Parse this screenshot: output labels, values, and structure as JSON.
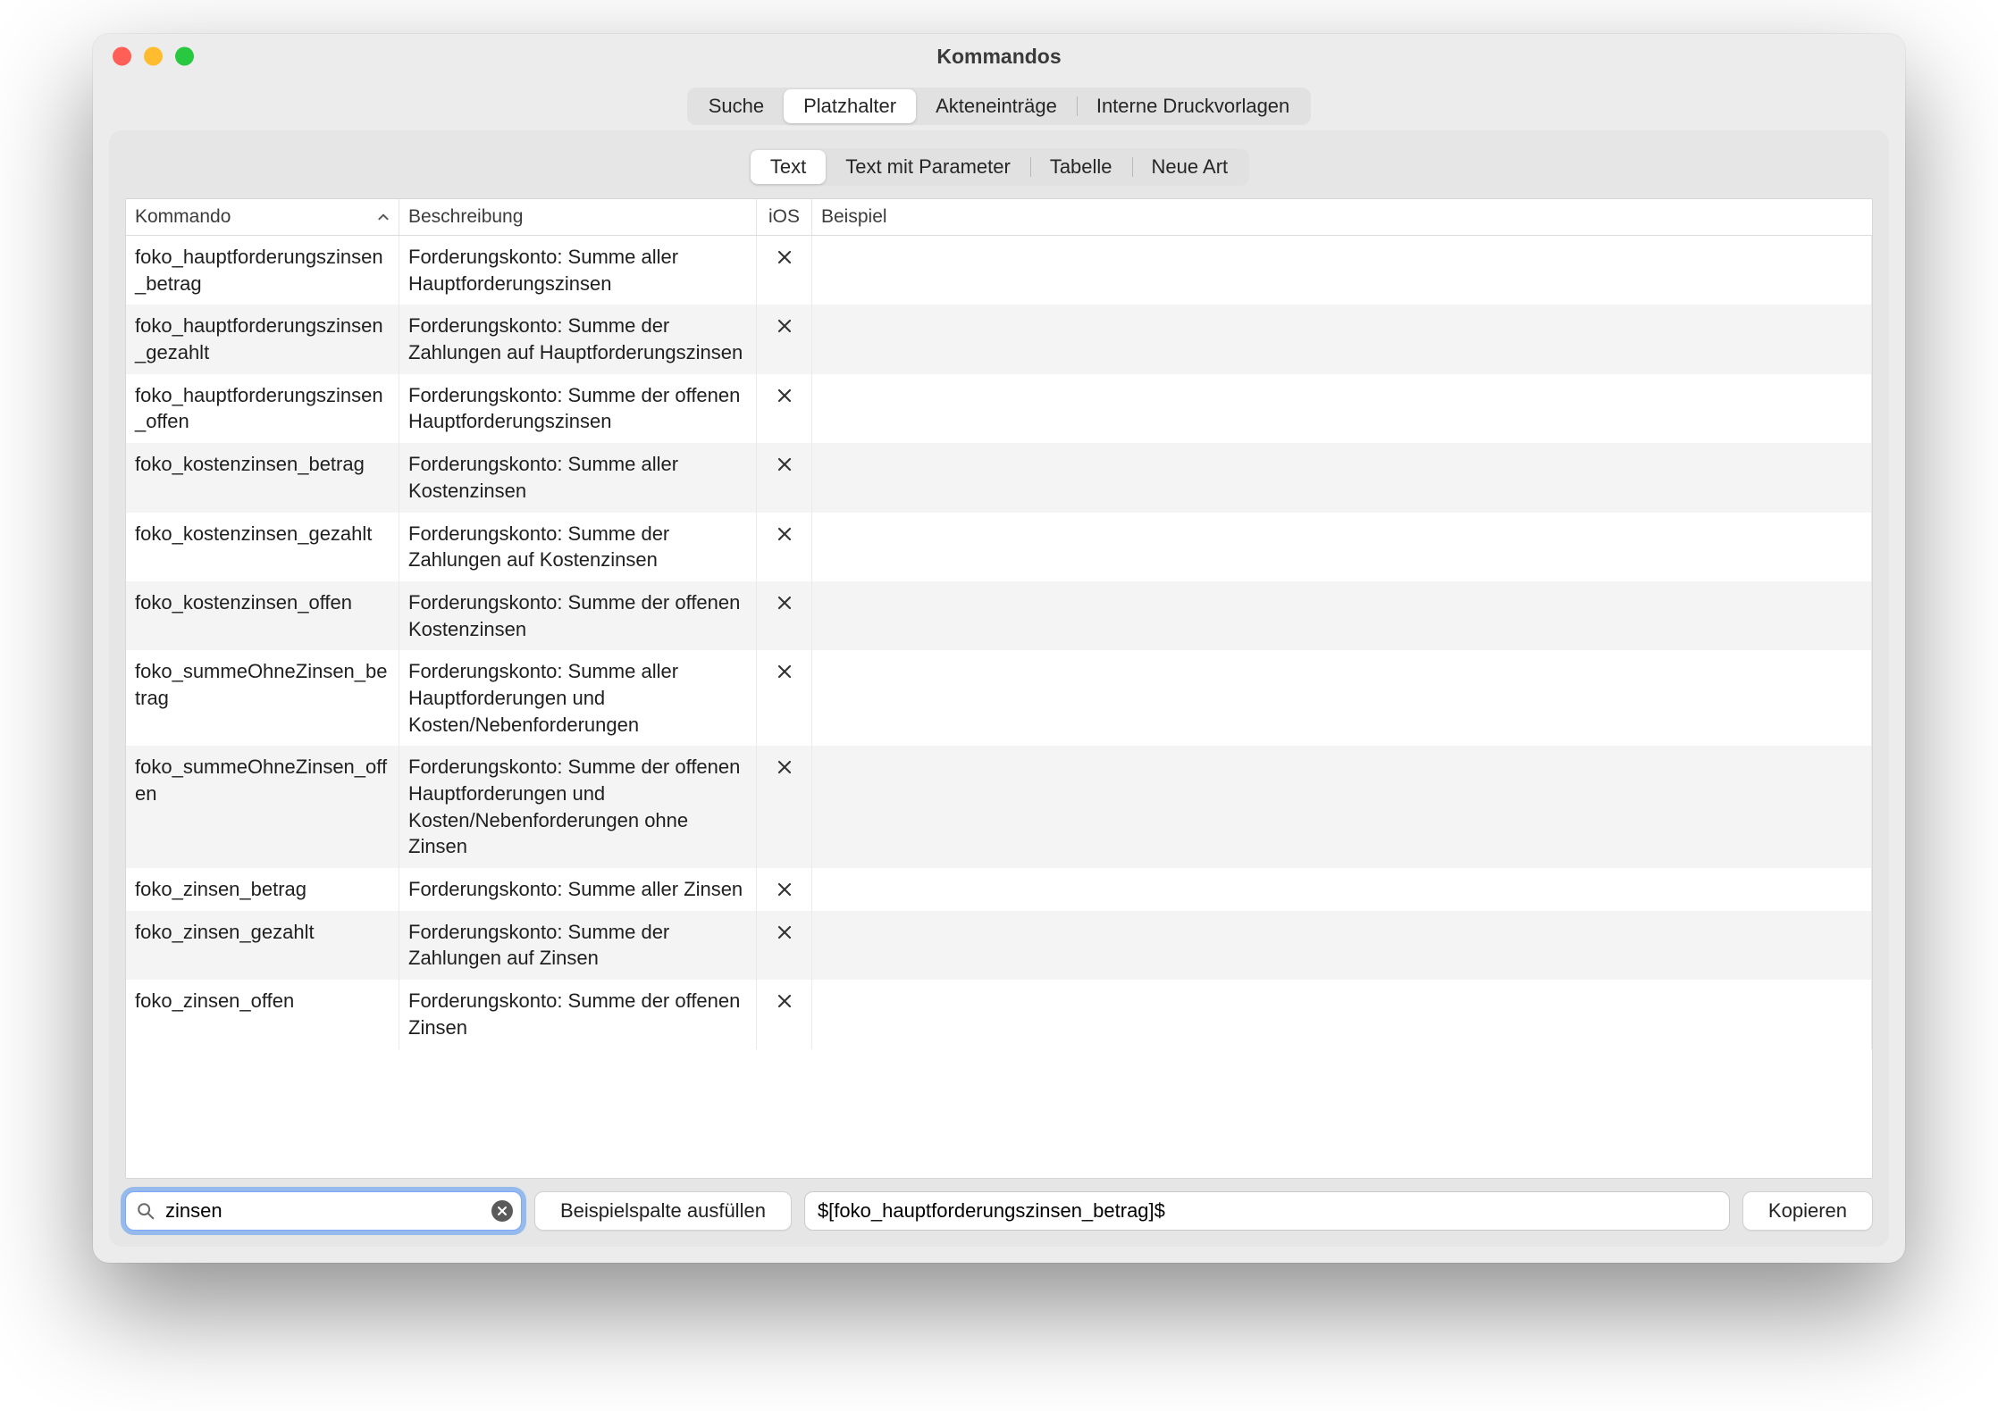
{
  "window": {
    "title": "Kommandos"
  },
  "tabs1": {
    "items": [
      "Suche",
      "Platzhalter",
      "Akteneinträge",
      "Interne Druckvorlagen"
    ],
    "active": 1
  },
  "tabs2": {
    "items": [
      "Text",
      "Text mit Parameter",
      "Tabelle",
      "Neue Art"
    ],
    "active": 0
  },
  "table": {
    "headers": {
      "kommando": "Kommando",
      "beschreibung": "Beschreibung",
      "ios": "iOS",
      "beispiel": "Beispiel"
    },
    "rows": [
      {
        "cmd": "foko_hauptforderungszinsen_betrag",
        "desc": "Forderungskonto: Summe aller Hauptforderungszinsen",
        "ios": "x",
        "ex": ""
      },
      {
        "cmd": "foko_hauptforderungszinsen_gezahlt",
        "desc": "Forderungskonto: Summe der Zahlungen auf Hauptforderungszinsen",
        "ios": "x",
        "ex": ""
      },
      {
        "cmd": "foko_hauptforderungszinsen_offen",
        "desc": "Forderungskonto: Summe der offenen Hauptforderungszinsen",
        "ios": "x",
        "ex": ""
      },
      {
        "cmd": "foko_kostenzinsen_betrag",
        "desc": "Forderungskonto: Summe aller Kostenzinsen",
        "ios": "x",
        "ex": ""
      },
      {
        "cmd": "foko_kostenzinsen_gezahlt",
        "desc": "Forderungskonto: Summe der Zahlungen auf Kostenzinsen",
        "ios": "x",
        "ex": ""
      },
      {
        "cmd": "foko_kostenzinsen_offen",
        "desc": "Forderungskonto: Summe der offenen Kostenzinsen",
        "ios": "x",
        "ex": ""
      },
      {
        "cmd": "foko_summeOhneZinsen_betrag",
        "desc": "Forderungskonto: Summe aller Hauptforderungen und Kosten/Nebenforderungen",
        "ios": "x",
        "ex": ""
      },
      {
        "cmd": "foko_summeOhneZinsen_offen",
        "desc": "Forderungskonto: Summe der offenen Hauptforderungen und Kosten/Nebenforderungen ohne Zinsen",
        "ios": "x",
        "ex": ""
      },
      {
        "cmd": "foko_zinsen_betrag",
        "desc": "Forderungskonto: Summe aller Zinsen",
        "ios": "x",
        "ex": ""
      },
      {
        "cmd": "foko_zinsen_gezahlt",
        "desc": "Forderungskonto: Summe der Zahlungen auf Zinsen",
        "ios": "x",
        "ex": ""
      },
      {
        "cmd": "foko_zinsen_offen",
        "desc": "Forderungskonto: Summe der offenen Zinsen",
        "ios": "x",
        "ex": ""
      }
    ]
  },
  "search": {
    "value": "zinsen"
  },
  "buttons": {
    "fill_example": "Beispielspalte ausfüllen",
    "copy": "Kopieren"
  },
  "result": {
    "value": "$[foko_hauptforderungszinsen_betrag]$"
  }
}
